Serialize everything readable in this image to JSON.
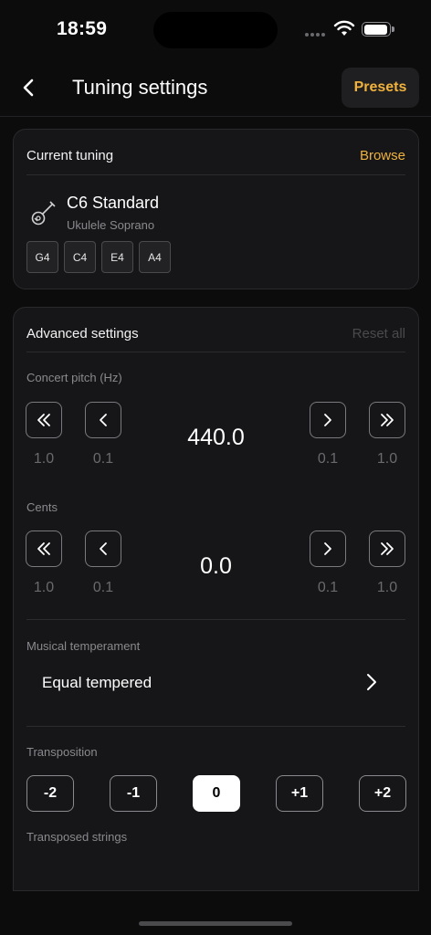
{
  "status_bar": {
    "time": "18:59"
  },
  "nav": {
    "title": "Tuning settings",
    "presets_label": "Presets"
  },
  "current_tuning": {
    "header": "Current tuning",
    "browse_label": "Browse",
    "name": "C6 Standard",
    "instrument": "Ukulele Soprano",
    "strings": [
      "G4",
      "C4",
      "E4",
      "A4"
    ],
    "icon": "guitar-icon"
  },
  "advanced": {
    "header": "Advanced settings",
    "reset_label": "Reset all",
    "concert_pitch": {
      "label": "Concert pitch (Hz)",
      "value": "440.0",
      "steps": {
        "big_down": "1.0",
        "small_down": "0.1",
        "small_up": "0.1",
        "big_up": "1.0"
      }
    },
    "cents": {
      "label": "Cents",
      "value": "0.0",
      "steps": {
        "big_down": "1.0",
        "small_down": "0.1",
        "small_up": "0.1",
        "big_up": "1.0"
      }
    },
    "temperament": {
      "label": "Musical temperament",
      "value": "Equal tempered"
    },
    "transposition": {
      "label": "Transposition",
      "options": [
        "-2",
        "-1",
        "0",
        "+1",
        "+2"
      ],
      "selected": "0"
    },
    "transposed_strings_label": "Transposed strings"
  },
  "colors": {
    "accent": "#f0b23c",
    "background": "#0c0c0d",
    "card": "#161618"
  }
}
